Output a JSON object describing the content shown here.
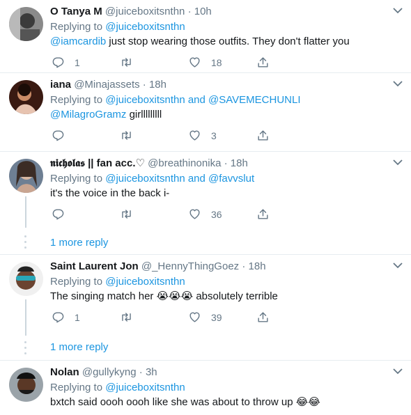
{
  "tweets": [
    {
      "name": "O Tanya M",
      "handle": "@juiceboxitsnthn",
      "sep": "·",
      "time": "10h",
      "replying_prefix": "Replying to",
      "replying_targets": "@juiceboxitsnthn",
      "mention": "@iamcardib",
      "text": " just stop wearing those outfits. They don't flatter you",
      "reply_count": "1",
      "retweet_count": "",
      "like_count": "18"
    },
    {
      "name": "iana",
      "handle": "@Minajassets",
      "sep": "·",
      "time": "18h",
      "replying_prefix": "Replying to",
      "replying_targets": "@juiceboxitsnthn and @SAVEMECHUNLI",
      "mention": "@MilagroGramz",
      "text": " girlllllllll",
      "reply_count": "",
      "retweet_count": "",
      "like_count": "3"
    },
    {
      "name": "𝖓𝖎𝖈𝖍𝖔𝖑𝖆𝖘 || fan acc.♡",
      "handle": "@breathinonika",
      "sep": "·",
      "time": "18h",
      "replying_prefix": "Replying to",
      "replying_targets": "@juiceboxitsnthn and @favvslut",
      "text": "it's the voice in the back i-",
      "reply_count": "",
      "retweet_count": "",
      "like_count": "36",
      "more_label": "1 more reply"
    },
    {
      "name": "Saint Laurent Jon",
      "handle": "@_HennyThingGoez",
      "sep": "·",
      "time": "18h",
      "replying_prefix": "Replying to",
      "replying_targets": "@juiceboxitsnthn",
      "text": "The singing match her ",
      "emoji": "😭😭😭",
      "text_after": " absolutely terrible",
      "reply_count": "1",
      "retweet_count": "",
      "like_count": "39",
      "more_label": "1 more reply"
    },
    {
      "name": "Nolan",
      "handle": "@gullykyng",
      "sep": "·",
      "time": "3h",
      "replying_prefix": "Replying to",
      "replying_targets": "@juiceboxitsnthn",
      "text": "bxtch said oooh oooh like she was about to throw up ",
      "emoji": "😂😂"
    }
  ],
  "colors": {
    "link": "#1b95e0",
    "secondary": "#657786",
    "divider": "#e6ecf0"
  },
  "icons": [
    "reply-icon",
    "retweet-icon",
    "like-icon",
    "share-icon",
    "chevron-down-icon"
  ]
}
